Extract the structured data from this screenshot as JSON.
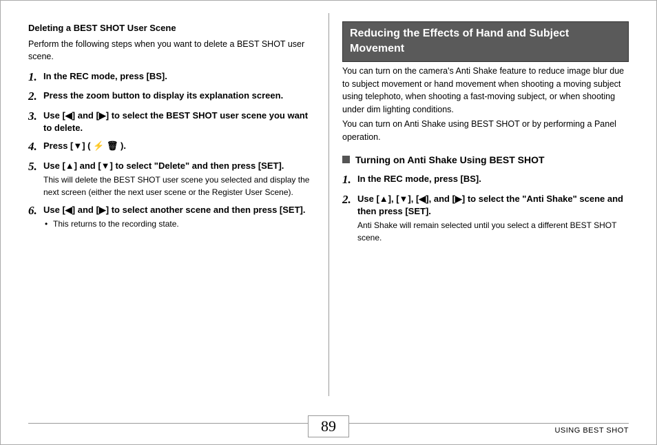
{
  "left": {
    "subhead": "Deleting a BEST SHOT User Scene",
    "intro": "Perform the following steps when you want to delete a BEST SHOT user scene.",
    "steps": [
      {
        "n": "1.",
        "title": "In the REC mode, press [BS]."
      },
      {
        "n": "2.",
        "title": "Press the zoom button to display its explanation screen."
      },
      {
        "n": "3.",
        "title": "Use [◀] and [▶] to select the BEST SHOT user scene you want to delete."
      },
      {
        "n": "4.",
        "title": "Press [▼] ( ⚡ 🗑 )."
      },
      {
        "n": "5.",
        "title": "Use [▲] and [▼] to select \"Delete\" and then press [SET].",
        "desc": "This will delete the BEST SHOT user scene you selected and display the next screen (either the next user scene or the Register User Scene)."
      },
      {
        "n": "6.",
        "title": "Use [◀] and [▶] to select another scene and then press [SET].",
        "bullet": "This returns to the recording state."
      }
    ]
  },
  "right": {
    "banner": "Reducing the Effects of Hand and Subject Movement",
    "para1": "You can turn on the camera's Anti Shake feature to reduce image blur due to subject movement or hand movement when shooting a moving subject using telephoto, when shooting a fast-moving subject, or when shooting under dim lighting conditions.",
    "para2": "You can turn on Anti Shake using BEST SHOT or by performing a Panel operation.",
    "subsection": "Turning on Anti Shake Using BEST SHOT",
    "steps": [
      {
        "n": "1.",
        "title": "In the REC mode, press [BS]."
      },
      {
        "n": "2.",
        "title": "Use [▲], [▼], [◀], and [▶] to select the \"Anti Shake\" scene and then press [SET].",
        "desc": "Anti Shake will remain selected until you select a different BEST SHOT scene."
      }
    ]
  },
  "footer": {
    "page": "89",
    "label": "USING BEST SHOT"
  }
}
